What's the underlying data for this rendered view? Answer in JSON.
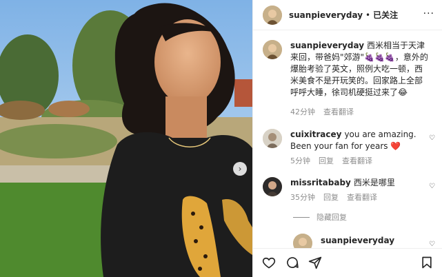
{
  "header": {
    "username": "suanpieveryday",
    "separator": "•",
    "follow_label": "已关注",
    "more_label": "···"
  },
  "caption": {
    "username": "suanpieveryday",
    "text": "西米相当于天津来回，带爸妈\"郊游\"🍇🍇🍇，意外的爆胎考验了英文，照例大吃一顿，西米美食不是开玩笑的。回家路上全部呼呼大睡，徐司机硬挺过来了😂",
    "time": "42分钟",
    "see_translation": "查看翻译"
  },
  "comments": [
    {
      "username": "cuixitracey",
      "text": "you are amazing. Been your fan for years ❤️",
      "time": "5分钟",
      "reply": "回复",
      "see_translation": "查看翻译"
    },
    {
      "username": "missritababy",
      "text": "西米是哪里",
      "time": "35分钟",
      "reply": "回复",
      "see_translation": "查看翻译"
    }
  ],
  "hide_replies": "隐藏回复",
  "reply_preview": {
    "username": "suanpieveryday"
  },
  "icons": {
    "like": "heart-icon",
    "comment": "comment-icon",
    "share": "paper-plane-icon",
    "save": "bookmark-icon",
    "next": "chevron-right-icon"
  },
  "colors": {
    "text": "#262626",
    "muted": "#8e8e8e",
    "heart_red": "#ed4956"
  }
}
